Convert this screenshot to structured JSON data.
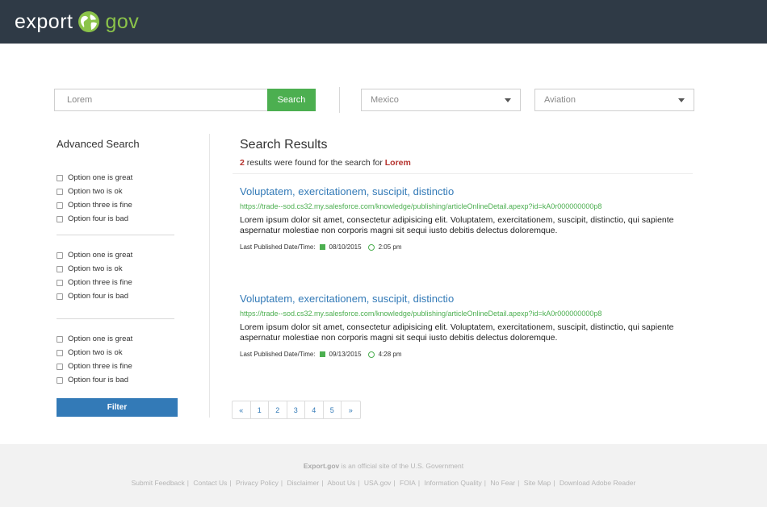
{
  "header": {
    "logo_left": "export",
    "logo_right": "gov"
  },
  "search": {
    "query": "Lorem",
    "button_label": "Search",
    "country": "Mexico",
    "industry": "Aviation"
  },
  "advanced": {
    "title": "Advanced Search",
    "groups": [
      [
        "Option one is great",
        "Option two is ok",
        "Option three is fine",
        "Option four is bad"
      ],
      [
        "Option one is great",
        "Option two is ok",
        "Option three is fine",
        "Option four is bad"
      ],
      [
        "Option one is great",
        "Option two is ok",
        "Option three is fine",
        "Option four is bad"
      ]
    ],
    "filter_label": "Filter"
  },
  "results": {
    "title": "Search Results",
    "count": "2",
    "count_text": " results were found for the search for ",
    "term": "Lorem",
    "items": [
      {
        "title": "Voluptatem, exercitationem, suscipit, distinctio",
        "url": "https://trade--sod.cs32.my.salesforce.com/knowledge/publishing/articleOnlineDetail.apexp?id=kA0r000000000p8",
        "desc": "Lorem ipsum dolor sit amet, consectetur adipisicing elit. Voluptatem, exercitationem, suscipit, distinctio, qui sapiente aspernatur molestiae non corporis magni sit sequi iusto debitis delectus doloremque.",
        "meta_label": "Last Published Date/Time:",
        "date": "08/10/2015",
        "time": "2:05 pm"
      },
      {
        "title": "Voluptatem, exercitationem, suscipit, distinctio",
        "url": "https://trade--sod.cs32.my.salesforce.com/knowledge/publishing/articleOnlineDetail.apexp?id=kA0r000000000p8",
        "desc": "Lorem ipsum dolor sit amet, consectetur adipisicing elit. Voluptatem, exercitationem, suscipit, distinctio, qui sapiente aspernatur molestiae non corporis magni sit sequi iusto debitis delectus doloremque.",
        "meta_label": "Last Published Date/Time:",
        "date": "09/13/2015",
        "time": "4:28 pm"
      }
    ]
  },
  "pagination": [
    "«",
    "1",
    "2",
    "3",
    "4",
    "5",
    "»"
  ],
  "footer": {
    "site": "Export.gov",
    "tagline": " is an official site of the U.S. Government",
    "links": [
      "Submit Feedback",
      "Contact Us",
      "Privacy Policy",
      "Disclaimer",
      "About Us",
      "USA.gov",
      "FOIA",
      "Information Quality",
      "No Fear",
      "Site Map",
      "Download Adobe Reader"
    ]
  },
  "colors": {
    "header_bg": "#2f3a46",
    "accent_green": "#4caf50",
    "link_blue": "#337ab7",
    "highlight_red": "#b5332e"
  },
  "icons": [
    "globe-icon",
    "caret-down-icon",
    "calendar-icon",
    "clock-icon"
  ]
}
